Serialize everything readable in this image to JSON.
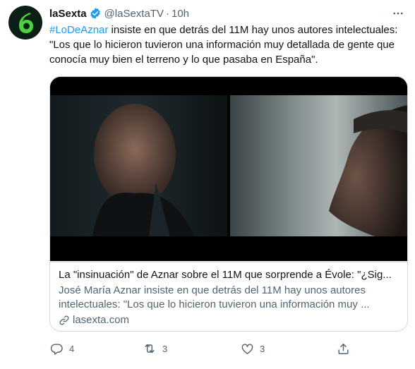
{
  "tweet": {
    "author_name": "laSexta",
    "handle": "@laSextaTV",
    "separator": "·",
    "time": "10h",
    "hashtag": "#LoDeAznar",
    "text": " insiste en que detrás del 11M hay unos autores intelectuales: \"Los que lo hicieron tuvieron una información muy detallada de gente que conocía muy bien el terreno y lo que pasaba en España\"."
  },
  "card": {
    "title": "La \"insinuación\" de Aznar sobre el 11M que sorprende a Évole: \"¿Sig...",
    "description": "José María Aznar insiste en que detrás del 11M hay unos autores intelectuales: \"Los que lo hicieron tuvieron una información muy ...",
    "domain": "lasexta.com"
  },
  "actions": {
    "reply_count": "4",
    "retweet_count": "3",
    "like_count": "3"
  },
  "colors": {
    "accent": "#1d9bf0",
    "brand_green": "#4cd13f",
    "secondary_text": "#536471"
  },
  "icons": [
    "verified-badge-icon",
    "more-icon",
    "reply-icon",
    "retweet-icon",
    "like-icon",
    "share-icon",
    "link-icon"
  ]
}
